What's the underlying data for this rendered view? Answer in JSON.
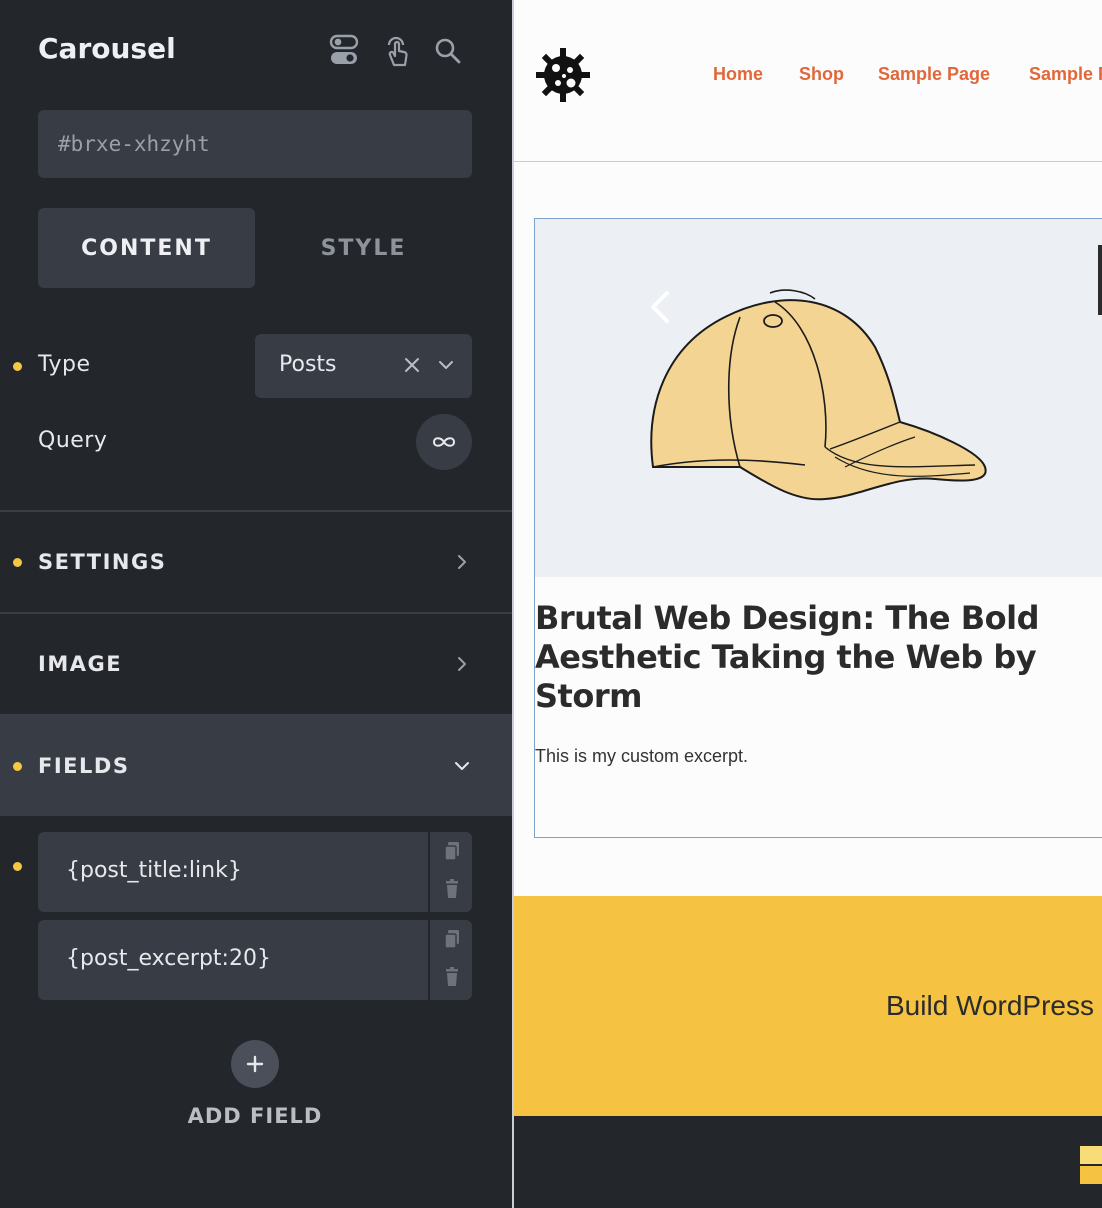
{
  "panel": {
    "title": "Carousel",
    "header_icons": [
      "toggle-icon",
      "touch-icon",
      "search-icon"
    ],
    "element_id": "#brxe-xhzyht",
    "tabs": [
      {
        "label": "CONTENT",
        "active": true
      },
      {
        "label": "STYLE",
        "active": false
      }
    ],
    "type": {
      "label": "Type",
      "value": "Posts"
    },
    "query": {
      "label": "Query"
    },
    "groups": {
      "settings": "SETTINGS",
      "image": "IMAGE",
      "fields": "FIELDS"
    },
    "fields": [
      {
        "value": "{post_title:link}"
      },
      {
        "value": "{post_excerpt:20}"
      }
    ],
    "add_field_label": "ADD FIELD",
    "accent_color": "#f5c843"
  },
  "preview": {
    "nav": [
      "Home",
      "Shop",
      "Sample Page",
      "Sample Page"
    ],
    "nav_color": "#e0683a",
    "slide": {
      "title": "Brutal Web Design: The Bold Aesthetic Taking the Web by Storm",
      "excerpt": "This is my custom excerpt."
    },
    "banner_text": "Build WordPress sites",
    "banner_color": "#f5c242"
  }
}
